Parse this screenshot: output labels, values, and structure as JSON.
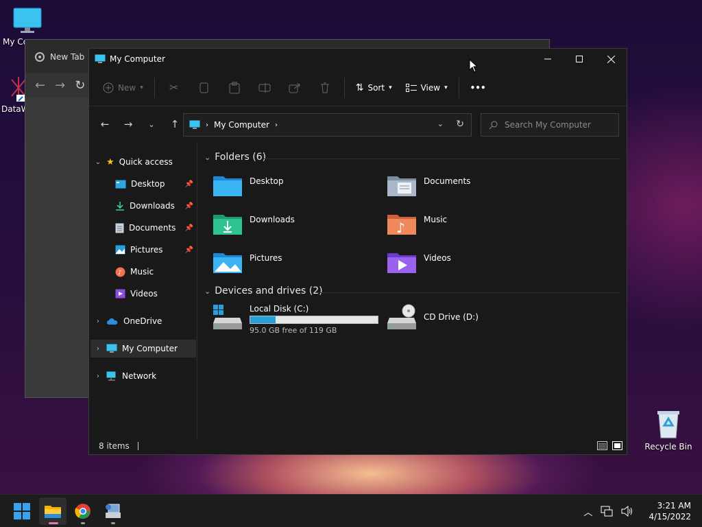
{
  "desktop": {
    "icons": [
      {
        "label": "My Co"
      },
      {
        "label": "DataW"
      },
      {
        "label": "Recycle Bin"
      }
    ]
  },
  "browser": {
    "tab_label": "New Tab"
  },
  "window": {
    "title": "My Computer"
  },
  "toolbar": {
    "new_label": "New",
    "sort_label": "Sort",
    "view_label": "View",
    "more_label": "•••"
  },
  "address": {
    "path": "My Computer",
    "search_placeholder": "Search My Computer"
  },
  "sidebar": {
    "quick_access": "Quick access",
    "pinned": [
      {
        "label": "Desktop"
      },
      {
        "label": "Downloads"
      },
      {
        "label": "Documents"
      },
      {
        "label": "Pictures"
      },
      {
        "label": "Music"
      },
      {
        "label": "Videos"
      }
    ],
    "onedrive": "OneDrive",
    "my_computer": "My Computer",
    "network": "Network"
  },
  "folders": {
    "header": "Folders (6)",
    "items": [
      {
        "label": "Desktop"
      },
      {
        "label": "Documents"
      },
      {
        "label": "Downloads"
      },
      {
        "label": "Music"
      },
      {
        "label": "Pictures"
      },
      {
        "label": "Videos"
      }
    ]
  },
  "drives": {
    "header": "Devices and drives (2)",
    "items": [
      {
        "label": "Local Disk (C:)",
        "free_text": "95.0 GB free of 119 GB",
        "used_fraction": 0.2
      },
      {
        "label": "CD Drive (D:)"
      }
    ]
  },
  "status": {
    "item_count": "8 items"
  },
  "clock": {
    "time": "3:21 AM",
    "date": "4/15/2022"
  },
  "colors": {
    "accent": "#0078d4",
    "drive_bar": "#26a0da"
  }
}
